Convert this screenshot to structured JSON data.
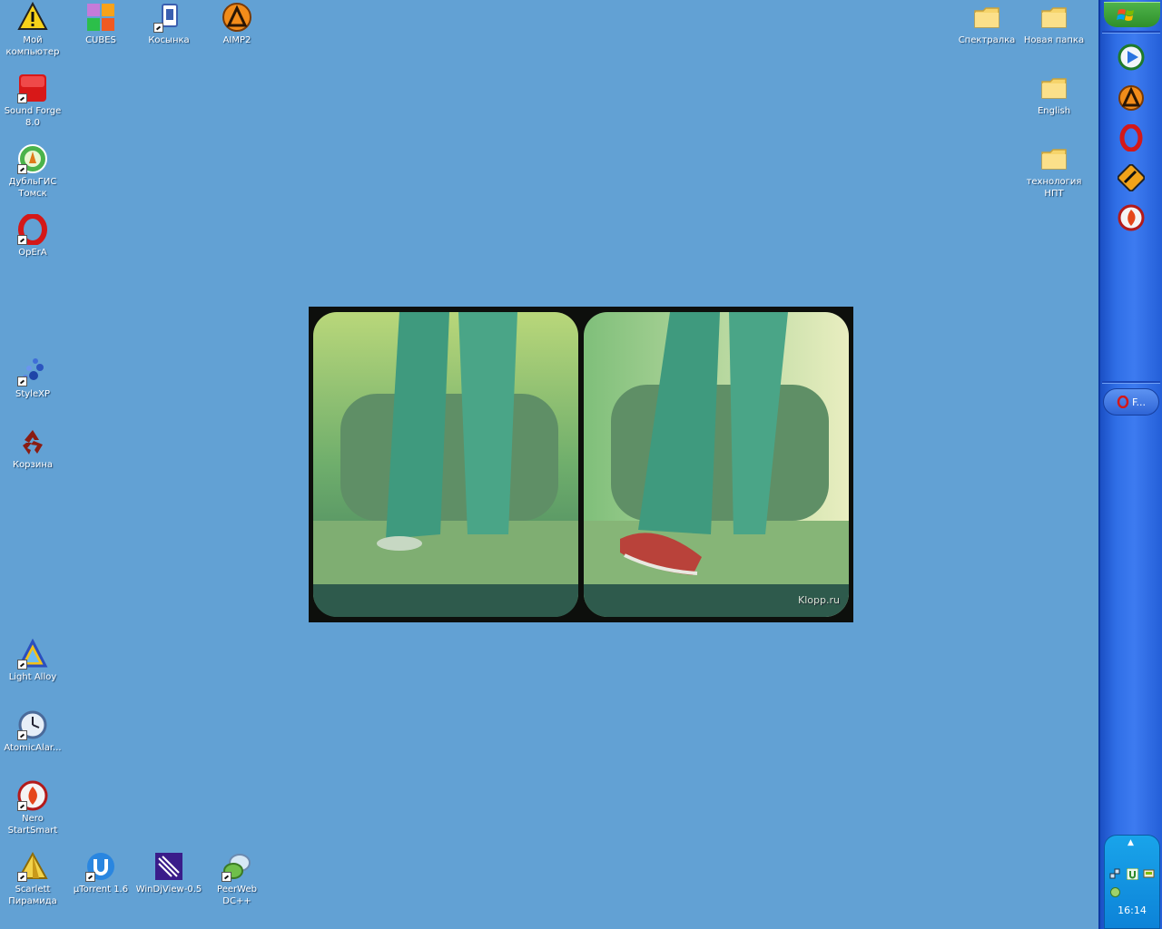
{
  "desktop_icons": {
    "my_computer": "Мой компьютер",
    "cubes": "CUBES",
    "kosynka": "Косынка",
    "aimp2": "AIMP2",
    "spektralka": "Спектралка",
    "new_folder": "Новая папка",
    "sound_forge": "Sound Forge 8.0",
    "english": "English",
    "dublgis": "ДубльГИС Томск",
    "tech_npt": "технология НПТ",
    "opera": "OpErA",
    "stylexp": "StyleXP",
    "recycle_bin": "Корзина",
    "light_alloy": "Light Alloy",
    "atomic_alarm": "AtomicAlar...",
    "nero": "Nero StartSmart",
    "scarlett": "Scarlett Пирамида",
    "utorrent": "µTorrent 1.6",
    "windjview": "WinDjView-0.5",
    "peerweb": "PeerWeb DC++"
  },
  "wallpaper": {
    "watermark": "Klopp.ru"
  },
  "taskbar": {
    "task_label": "F...",
    "clock": "16:14",
    "tray_arrow": "▲"
  },
  "colors": {
    "desktop": "#62a1d4",
    "taskbar": "#2f6ee6",
    "tray": "#0d83d8"
  }
}
